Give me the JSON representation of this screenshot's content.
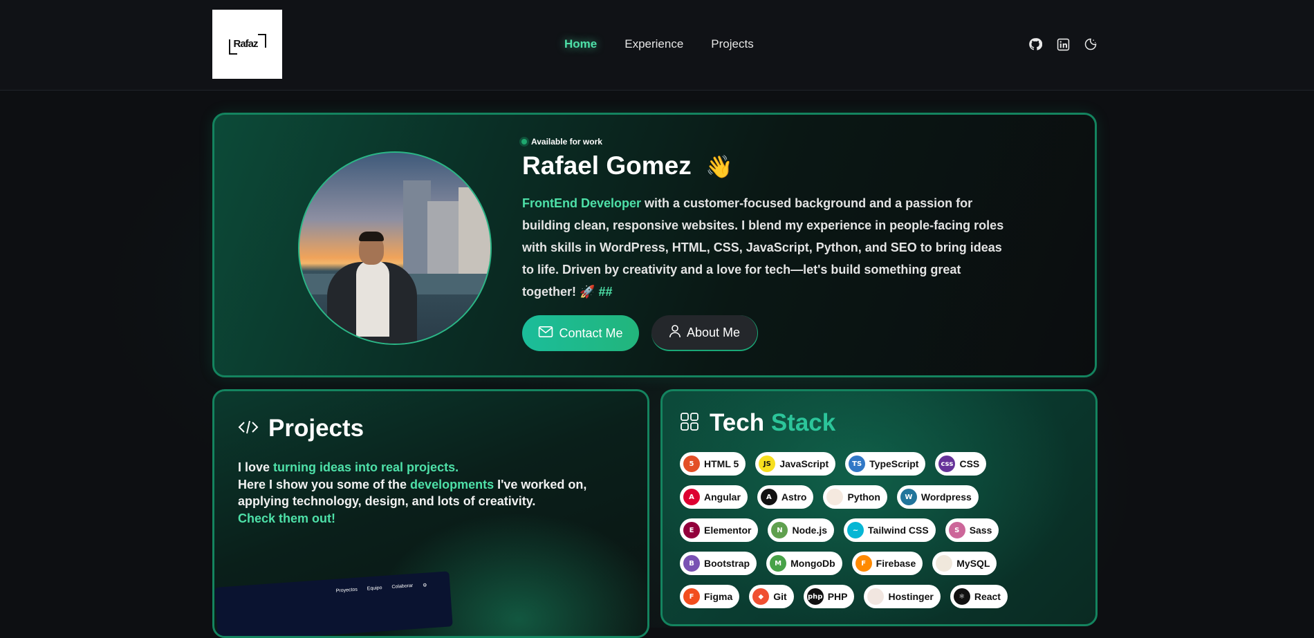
{
  "logo": {
    "text": "Rafaz"
  },
  "nav": [
    {
      "label": "Home",
      "active": true
    },
    {
      "label": "Experience",
      "active": false
    },
    {
      "label": "Projects",
      "active": false
    }
  ],
  "header_icons": [
    "github-icon",
    "linkedin-icon",
    "theme-toggle-icon"
  ],
  "hero": {
    "status": "Available for work",
    "name": "Rafael Gomez",
    "wave": "👋",
    "role": "FrontEnd Developer",
    "bio": " with a customer-focused background and a passion for building clean, responsive websites. I blend my experience in people-facing roles with skills in WordPress, HTML, CSS, JavaScript, Python, and SEO to bring ideas to life. Driven by creativity and a love for tech—let's build something great together! 🚀",
    "bio_suffix": "##",
    "contact_label": "Contact Me",
    "about_label": "About Me"
  },
  "projects": {
    "title": "Projects",
    "line1_pre": "I love ",
    "line1_hl": "turning ideas into real projects.",
    "line2_pre": "Here I show you some of the ",
    "line2_hl": "developments",
    "line2_post": " I've worked on, applying technology, design, and lots of creativity.",
    "cta": "Check them out!",
    "preview_nav": [
      "Proyectos",
      "Equipo",
      "Colaborar"
    ]
  },
  "tech_stack": {
    "title_a": "Tech",
    "title_b": "Stack",
    "rows": [
      [
        {
          "label": "HTML 5",
          "icon": "html5-icon",
          "color": "#e34f26",
          "glyph": "5"
        },
        {
          "label": "JavaScript",
          "icon": "javascript-icon",
          "color": "#f7df1e",
          "glyph": "JS"
        },
        {
          "label": "TypeScript",
          "icon": "typescript-icon",
          "color": "#3178c6",
          "glyph": "TS"
        },
        {
          "label": "CSS",
          "icon": "css-icon",
          "color": "#663399",
          "glyph": "css"
        }
      ],
      [
        {
          "label": "Angular",
          "icon": "angular-icon",
          "color": "#dd0031",
          "glyph": "A"
        },
        {
          "label": "Astro",
          "icon": "astro-icon",
          "color": "#111111",
          "glyph": "A"
        },
        {
          "label": "Python",
          "icon": "python-icon",
          "color": "#f5e9df",
          "glyph": ""
        },
        {
          "label": "Wordpress",
          "icon": "wordpress-icon",
          "color": "#21759b",
          "glyph": "W"
        }
      ],
      [
        {
          "label": "Elementor",
          "icon": "elementor-icon",
          "color": "#92003b",
          "glyph": "E"
        },
        {
          "label": "Node.js",
          "icon": "nodejs-icon",
          "color": "#5fa04e",
          "glyph": "N"
        },
        {
          "label": "Tailwind CSS",
          "icon": "tailwind-icon",
          "color": "#06b6d4",
          "glyph": "~"
        },
        {
          "label": "Sass",
          "icon": "sass-icon",
          "color": "#cc6699",
          "glyph": "S"
        }
      ],
      [
        {
          "label": "Bootstrap",
          "icon": "bootstrap-icon",
          "color": "#7952b3",
          "glyph": "B"
        },
        {
          "label": "MongoDb",
          "icon": "mongodb-icon",
          "color": "#47a248",
          "glyph": "M"
        },
        {
          "label": "Firebase",
          "icon": "firebase-icon",
          "color": "#ff8a00",
          "glyph": "F"
        },
        {
          "label": "MySQL",
          "icon": "mysql-icon",
          "color": "#f0e8dc",
          "glyph": ""
        }
      ],
      [
        {
          "label": "Figma",
          "icon": "figma-icon",
          "color": "#f24e1e",
          "glyph": "F"
        },
        {
          "label": "Git",
          "icon": "git-icon",
          "color": "#f05032",
          "glyph": "◆"
        },
        {
          "label": "PHP",
          "icon": "php-icon",
          "color": "#111111",
          "glyph": "php"
        },
        {
          "label": "Hostinger",
          "icon": "hostinger-icon",
          "color": "#f1e6e0",
          "glyph": ""
        },
        {
          "label": "React",
          "icon": "react-icon",
          "color": "#111111",
          "glyph": "⚛"
        }
      ]
    ]
  }
}
